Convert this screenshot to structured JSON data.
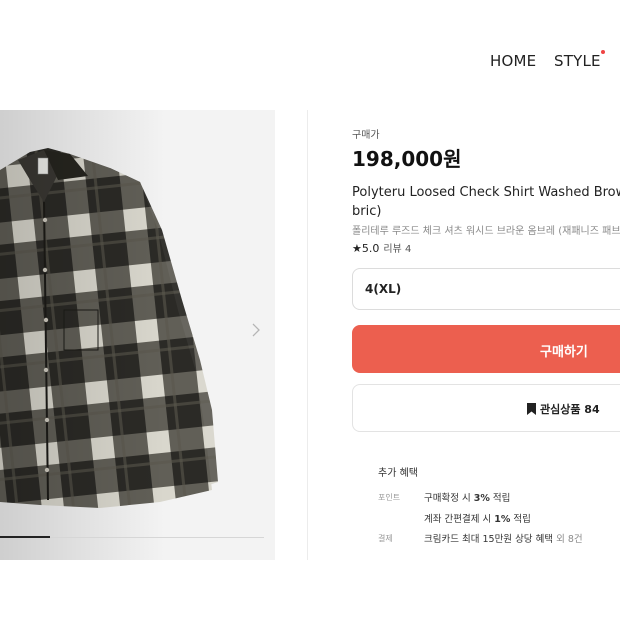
{
  "nav": {
    "home": "HOME",
    "style": "STYLE"
  },
  "product": {
    "price_label": "구매가",
    "price": "198,000원",
    "title_line1": "Polyteru Loosed Check Shirt Washed Brow",
    "title_line2": "bric)",
    "subtitle": "폴리테루 루즈드 체크 셔츠 워시드 브라운 옴브레 (재패니즈 패브",
    "rating_value": "★5.0",
    "review_label": "리뷰 4"
  },
  "option": {
    "selected": "4(XL)"
  },
  "actions": {
    "buy_label": "구매하기",
    "wish_label": "관심상품 84"
  },
  "benefits": {
    "title": "추가 혜택",
    "point_label": "포인트",
    "point_line1_pre": "구매확정 시 ",
    "point_line1_bold": "3%",
    "point_line1_post": " 적립",
    "point_line2_pre": "계좌 간편결제 시 ",
    "point_line2_bold": "1%",
    "point_line2_post": " 적립",
    "pay_label": "결제",
    "pay_line_pre": "크림카드 최대 15만원 상당 혜택",
    "pay_line_muted": " 외 8건"
  },
  "gallery": {
    "progress": 0.19
  },
  "colors": {
    "accent": "#ec5f4f",
    "nav_dot": "#ef4444"
  }
}
